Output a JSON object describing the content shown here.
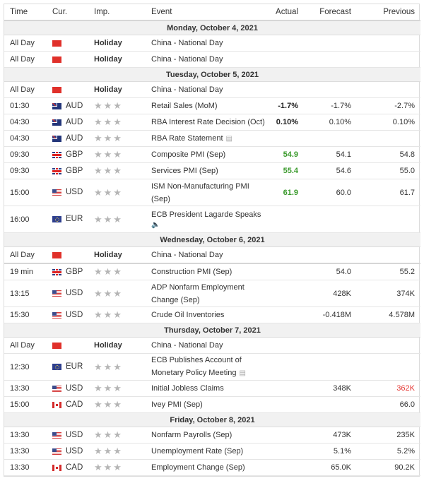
{
  "header": {
    "time": "Time",
    "currency": "Cur.",
    "importance": "Imp.",
    "event": "Event",
    "actual": "Actual",
    "forecast": "Forecast",
    "previous": "Previous"
  },
  "icons": {
    "star": "★★★",
    "doc": "▤",
    "speaker": "🔈"
  },
  "colors": {
    "better": "#3a9a2c",
    "worse": "#e53935",
    "date_bg": "#f1f1f1"
  },
  "days": [
    {
      "date": "Monday, October 4, 2021",
      "events": [
        {
          "time": "All Day",
          "flag": "china-flag",
          "currency": "",
          "importance": "Holiday",
          "event": "China - National Day",
          "actual": "",
          "forecast": "",
          "previous": ""
        },
        {
          "time": "All Day",
          "flag": "china-flag",
          "currency": "",
          "importance": "Holiday",
          "event": "China - National Day",
          "actual": "",
          "forecast": "",
          "previous": ""
        }
      ]
    },
    {
      "date": "Tuesday, October 5, 2021",
      "events": [
        {
          "time": "All Day",
          "flag": "china-flag",
          "currency": "",
          "importance": "Holiday",
          "event": "China - National Day",
          "actual": "",
          "forecast": "",
          "previous": ""
        },
        {
          "time": "01:30",
          "flag": "australia-flag",
          "currency": "AUD",
          "importance": "3",
          "event": "Retail Sales (MoM)",
          "actual": "-1.7%",
          "forecast": "-1.7%",
          "previous": "-2.7%"
        },
        {
          "time": "04:30",
          "flag": "australia-flag",
          "currency": "AUD",
          "importance": "3",
          "event": "RBA Interest Rate Decision (Oct)",
          "actual": "0.10%",
          "forecast": "0.10%",
          "previous": "0.10%"
        },
        {
          "time": "04:30",
          "flag": "australia-flag",
          "currency": "AUD",
          "importance": "3",
          "event": "RBA Rate Statement",
          "actual": "",
          "forecast": "",
          "previous": ""
        },
        {
          "time": "09:30",
          "flag": "uk-flag",
          "currency": "GBP",
          "importance": "3",
          "event": "Composite PMI (Sep)",
          "actual": "54.9",
          "forecast": "54.1",
          "previous": "54.8"
        },
        {
          "time": "09:30",
          "flag": "uk-flag",
          "currency": "GBP",
          "importance": "3",
          "event": "Services PMI (Sep)",
          "actual": "55.4",
          "forecast": "54.6",
          "previous": "55.0"
        },
        {
          "time": "15:00",
          "flag": "us-flag",
          "currency": "USD",
          "importance": "3",
          "event": "ISM Non-Manufacturing PMI (Sep)",
          "actual": "61.9",
          "forecast": "60.0",
          "previous": "61.7"
        },
        {
          "time": "16:00",
          "flag": "eu-flag",
          "currency": "EUR",
          "importance": "3",
          "event": "ECB President Lagarde Speaks",
          "actual": "",
          "forecast": "",
          "previous": ""
        }
      ]
    },
    {
      "date": "Wednesday, October 6, 2021",
      "events": [
        {
          "time": "All Day",
          "flag": "china-flag",
          "currency": "",
          "importance": "Holiday",
          "event": "China - National Day",
          "actual": "",
          "forecast": "",
          "previous": ""
        },
        {
          "time": "19 min",
          "flag": "uk-flag",
          "currency": "GBP",
          "importance": "3",
          "event": "Construction PMI (Sep)",
          "actual": "",
          "forecast": "54.0",
          "previous": "55.2"
        },
        {
          "time": "13:15",
          "flag": "us-flag",
          "currency": "USD",
          "importance": "3",
          "event": "ADP Nonfarm Employment Change (Sep)",
          "actual": "",
          "forecast": "428K",
          "previous": "374K"
        },
        {
          "time": "15:30",
          "flag": "us-flag",
          "currency": "USD",
          "importance": "3",
          "event": "Crude Oil Inventories",
          "actual": "",
          "forecast": "-0.418M",
          "previous": "4.578M"
        }
      ]
    },
    {
      "date": "Thursday, October 7, 2021",
      "events": [
        {
          "time": "All Day",
          "flag": "china-flag",
          "currency": "",
          "importance": "Holiday",
          "event": "China - National Day",
          "actual": "",
          "forecast": "",
          "previous": ""
        },
        {
          "time": "12:30",
          "flag": "eu-flag",
          "currency": "EUR",
          "importance": "3",
          "event": "ECB Publishes Account of Monetary Policy Meeting",
          "actual": "",
          "forecast": "",
          "previous": ""
        },
        {
          "time": "13:30",
          "flag": "us-flag",
          "currency": "USD",
          "importance": "3",
          "event": "Initial Jobless Claims",
          "actual": "",
          "forecast": "348K",
          "previous": "362K"
        },
        {
          "time": "15:00",
          "flag": "canada-flag",
          "currency": "CAD",
          "importance": "3",
          "event": "Ivey PMI (Sep)",
          "actual": "",
          "forecast": "",
          "previous": "66.0"
        }
      ]
    },
    {
      "date": "Friday, October 8, 2021",
      "events": [
        {
          "time": "13:30",
          "flag": "us-flag",
          "currency": "USD",
          "importance": "3",
          "event": "Nonfarm Payrolls (Sep)",
          "actual": "",
          "forecast": "473K",
          "previous": "235K"
        },
        {
          "time": "13:30",
          "flag": "us-flag",
          "currency": "USD",
          "importance": "3",
          "event": "Unemployment Rate (Sep)",
          "actual": "",
          "forecast": "5.1%",
          "previous": "5.2%"
        },
        {
          "time": "13:30",
          "flag": "canada-flag",
          "currency": "CAD",
          "importance": "3",
          "event": "Employment Change (Sep)",
          "actual": "",
          "forecast": "65.0K",
          "previous": "90.2K"
        }
      ]
    }
  ]
}
